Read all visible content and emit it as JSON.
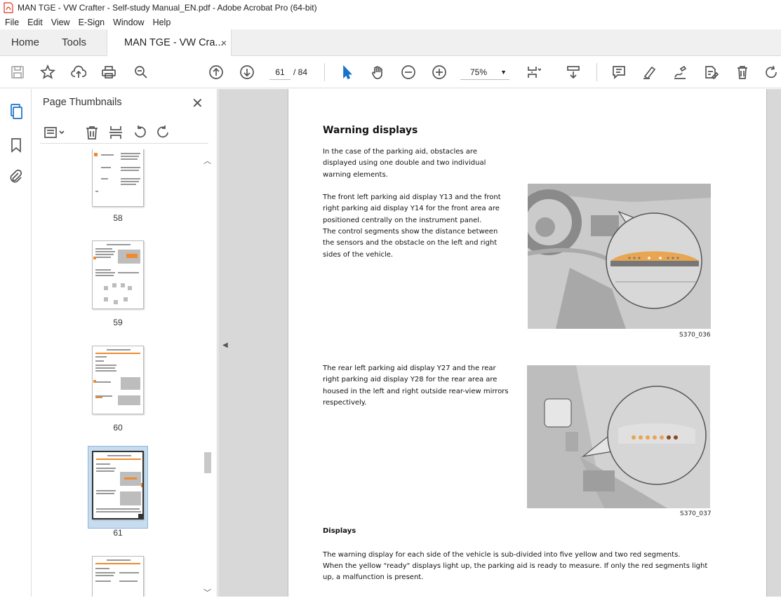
{
  "window": {
    "title": "MAN TGE - VW Crafter - Self-study Manual_EN.pdf - Adobe Acrobat Pro (64-bit)"
  },
  "menu": [
    "File",
    "Edit",
    "View",
    "E-Sign",
    "Window",
    "Help"
  ],
  "tabs": {
    "home": "Home",
    "tools": "Tools",
    "document": "MAN TGE - VW Cra...",
    "close": "×"
  },
  "toolbar": {
    "current_page": "61",
    "page_total": "/ 84",
    "zoom": "75%"
  },
  "panel": {
    "title": "Page Thumbnails",
    "close": "✕",
    "thumbnails": [
      {
        "label": "58"
      },
      {
        "label": "59"
      },
      {
        "label": "60"
      },
      {
        "label": "61",
        "selected": true
      },
      {
        "label": ""
      }
    ]
  },
  "page": {
    "heading": "Warning displays",
    "para1": "In the case of the parking aid, obstacles are displayed using one double and two individual warning elements.",
    "para2": "The front left parking aid display Y13 and the front right parking aid display Y14 for the front area are positioned centrally on the instrument panel.",
    "para3": "The control segments show the distance between the sensors and the obstacle on the left and right sides of the vehicle.",
    "caption1": "S370_036",
    "para4": "The rear left parking aid display Y27 and the rear right parking aid display Y28 for the rear area are housed in the left and right outside rear-view mirrors respectively.",
    "caption2": "S370_037",
    "subheading": "Displays",
    "para5": "The warning display for each side of the vehicle is sub-divided into five yellow and two red segments.",
    "para6": "When the yellow \"ready\" displays light up, the parking aid is ready to measure. If only the red segments light up, a malfunction is present."
  },
  "colors": {
    "accent": "#f08a2c",
    "selection": "#c7dcef",
    "workspace": "#d8d8d8"
  }
}
